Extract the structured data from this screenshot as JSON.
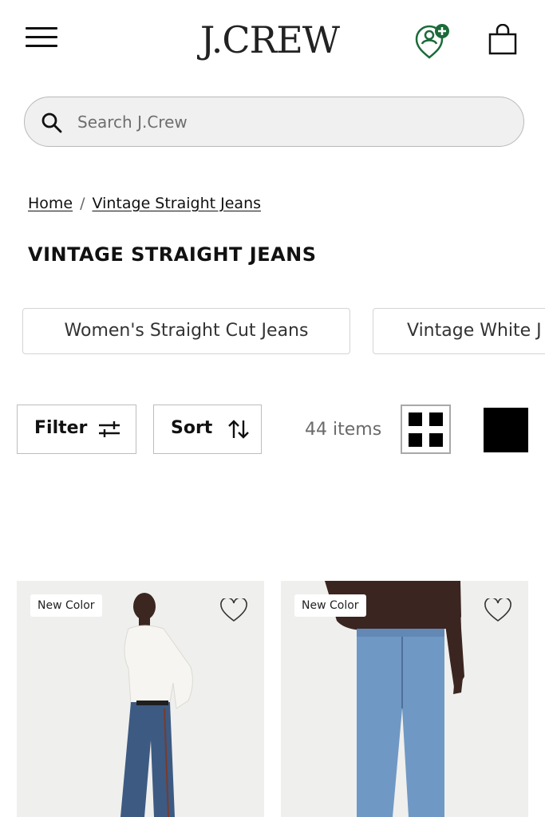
{
  "header": {
    "logo": "J.CREW",
    "menu_icon": "hamburger-menu-icon",
    "account_icon": "account-add-icon",
    "bag_icon": "shopping-bag-icon",
    "accent_color": "#1b6b3a"
  },
  "search": {
    "placeholder": "Search J.Crew",
    "value": ""
  },
  "breadcrumb": {
    "home": "Home",
    "separator": "/",
    "current": "Vintage Straight Jeans"
  },
  "page_title": "VINTAGE STRAIGHT JEANS",
  "chips": [
    {
      "label": "Women's Straight Cut Jeans"
    },
    {
      "label": "Vintage White J"
    }
  ],
  "toolbar": {
    "filter_label": "Filter",
    "sort_label": "Sort",
    "item_count": "44 items"
  },
  "products": [
    {
      "badge": "New Color",
      "favorite_icon": "heart-outline-icon"
    },
    {
      "badge": "New Color",
      "favorite_icon": "heart-outline-icon"
    }
  ]
}
